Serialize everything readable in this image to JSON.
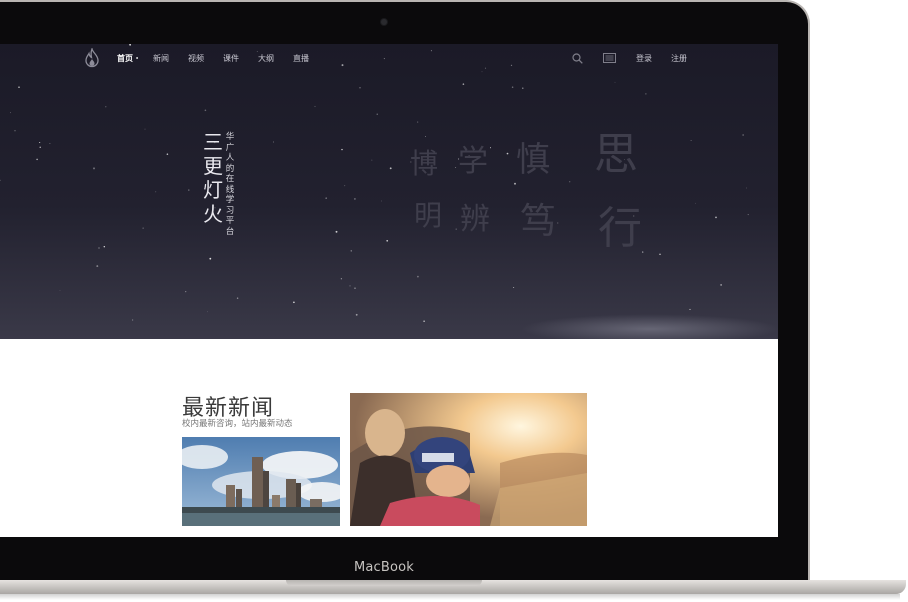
{
  "device": {
    "brand_label": "MacBook"
  },
  "nav": {
    "logo": "flame-logo-icon",
    "items": [
      {
        "label": "首页",
        "active": true
      },
      {
        "label": "新闻",
        "active": false
      },
      {
        "label": "视频",
        "active": false
      },
      {
        "label": "课件",
        "active": false
      },
      {
        "label": "大纲",
        "active": false
      },
      {
        "label": "直播",
        "active": false
      }
    ],
    "search_icon": "search-icon",
    "reader_icon": "reader-icon",
    "login_label": "登录",
    "register_label": "注册"
  },
  "hero": {
    "title": "三更灯火",
    "subtitle": "华广人的在线学习平台",
    "motto": [
      "博",
      "学",
      "慎",
      "思",
      "明",
      "辨",
      "笃",
      "行"
    ]
  },
  "news": {
    "title": "最新新闻",
    "subtitle": "校内最新咨询，站内最新动态"
  },
  "colors": {
    "hero_background": "#1b1a27",
    "nav_active": "#ffffff",
    "nav_text": "#c9c8d2",
    "motto_text": "#3f3e4c"
  }
}
